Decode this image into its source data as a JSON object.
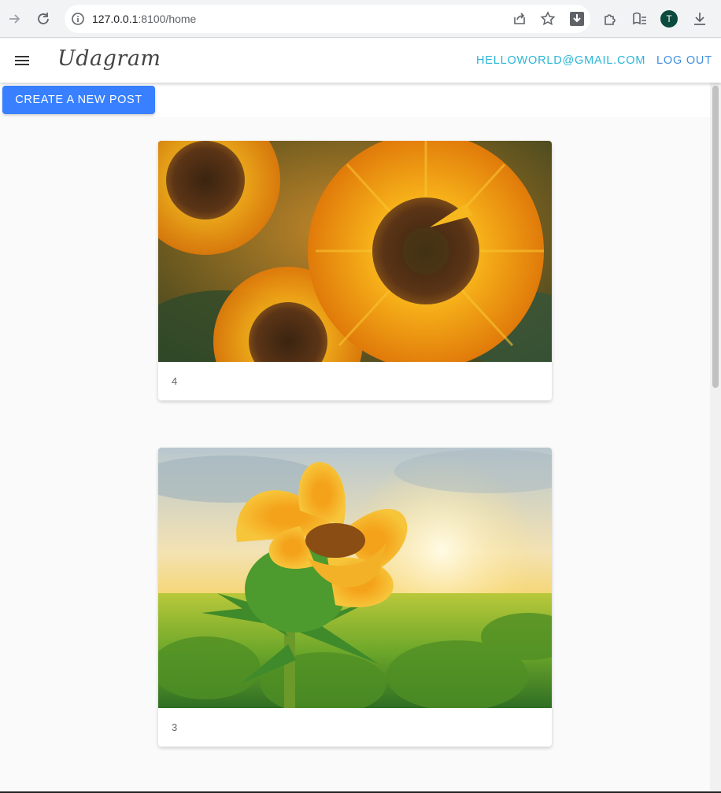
{
  "browser": {
    "url_host": "127.0.0.1",
    "url_path": ":8100/home",
    "profile_initial": "T"
  },
  "header": {
    "brand": "Udagram",
    "email_link": "HELLOWORLD@GMAIL.COM",
    "logout_link": "LOG OUT"
  },
  "toolbar": {
    "create_label": "CREATE A NEW POST"
  },
  "feed": {
    "posts": [
      {
        "caption": "4",
        "image": "sunflowers-field-closeup"
      },
      {
        "caption": "3",
        "image": "sunflower-at-sunset"
      }
    ]
  },
  "colors": {
    "primary_button": "#3880ff",
    "email_link": "#29b6d6",
    "logout_link": "#3f8fe0",
    "avatar": "#0b4a3e"
  }
}
